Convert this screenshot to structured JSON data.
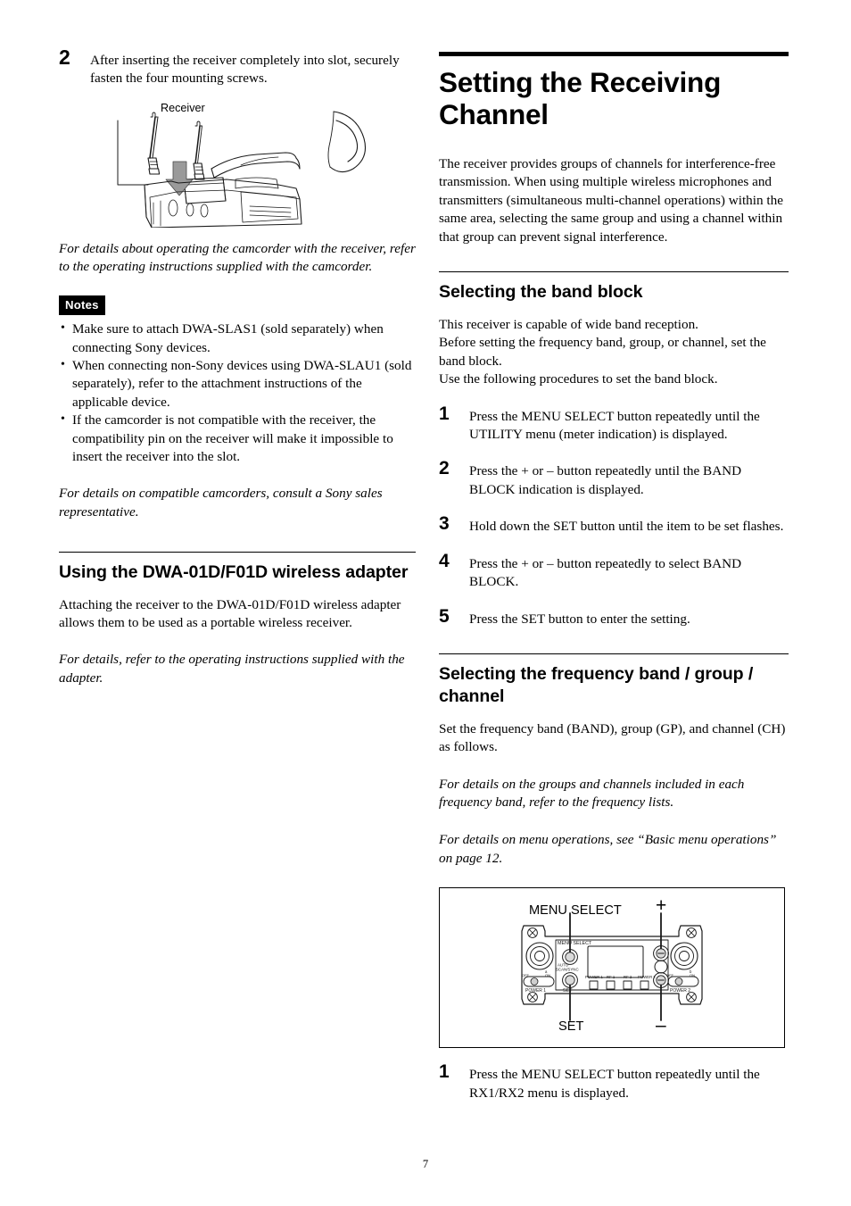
{
  "page": {
    "number": "7"
  },
  "left_column": {
    "step2": {
      "number": "2",
      "text": "After inserting the receiver completely into slot, securely fasten the four mounting screws."
    },
    "figure_camcorder": {
      "label_receiver": "Receiver",
      "caption_alt": "Line drawing of a camcorder with the wireless receiver being inserted into the slot"
    },
    "note_camcorder_italic": "For details about operating the camcorder with the receiver, refer to the operating instructions supplied with the camcorder.",
    "notes_tag": "Notes",
    "notes": [
      "Make sure to attach DWA-SLAS1 (sold separately) when connecting Sony devices.",
      "When connecting non-Sony devices using DWA-SLAU1 (sold separately), refer to the attachment instructions of the applicable device.",
      "If the camcorder is not compatible with the receiver, the compatibility pin on the receiver will make it impossible to insert the receiver into the slot."
    ],
    "note_compatible_italic": "For details on compatible camcorders, consult a Sony sales representative.",
    "section_adapter": {
      "heading": "Using the DWA-01D/F01D wireless adapter",
      "body": "Attaching the receiver to the DWA-01D/F01D wireless adapter allows them to be used as a portable wireless receiver.",
      "italic_note": "For details, refer to the operating instructions supplied with the adapter."
    }
  },
  "right_column": {
    "doc_title": "Setting the Receiving Channel",
    "intro": "The receiver provides groups of channels for interference-free transmission. When using multiple wireless microphones and transmitters (simultaneous multi-channel operations) within the same area, selecting the same group and using a channel within that group can prevent signal interference.",
    "section_band_block": {
      "heading": "Selecting the band block",
      "body_lines": [
        "This receiver is capable of wide band reception.",
        "Before setting the frequency band, group, or channel, set the band block.",
        "Use the following procedures to set the band block."
      ],
      "steps": [
        {
          "number": "1",
          "text": "Press the MENU SELECT button repeatedly until the UTILITY menu (meter indication) is displayed."
        },
        {
          "number": "2",
          "text": "Press the + or – button repeatedly until the BAND BLOCK indication is displayed."
        },
        {
          "number": "3",
          "text": "Hold down the SET button until the item to be set flashes."
        },
        {
          "number": "4",
          "text": "Press the + or – button repeatedly to select BAND BLOCK."
        },
        {
          "number": "5",
          "text": "Press the SET button to enter the setting."
        }
      ]
    },
    "section_freq": {
      "heading": "Selecting the frequency band / group / channel",
      "body": "Set the frequency band (BAND), group (GP), and channel (CH) as follows.",
      "italic_note_1": "For details on the groups and channels included in each frequency band, refer to the frequency lists.",
      "italic_note_2": "For details on menu operations, see “Basic menu operations” on page 12.",
      "figure_panel": {
        "callouts": {
          "menu_select": "MENU SELECT",
          "plus": "+",
          "set": "SET",
          "minus": "–"
        },
        "panel_labels": {
          "menu_select": "MENU SELECT",
          "auto_scan_sync": "AUTO SCAN/SYNC",
          "set": "SET",
          "power1": "POWER 1",
          "power2": "POWER 2",
          "rf1": "RF 1",
          "rf2": "RF 2",
          "power1_led": "POWER 1",
          "power2_led": "POWER 2",
          "antenna_a": "a",
          "antenna_b": "b",
          "switch_off": "OFF",
          "switch_on": "ON"
        }
      },
      "step_after_figure": {
        "number": "1",
        "text": "Press the MENU SELECT button repeatedly until the RX1/RX2 menu is displayed."
      }
    }
  }
}
